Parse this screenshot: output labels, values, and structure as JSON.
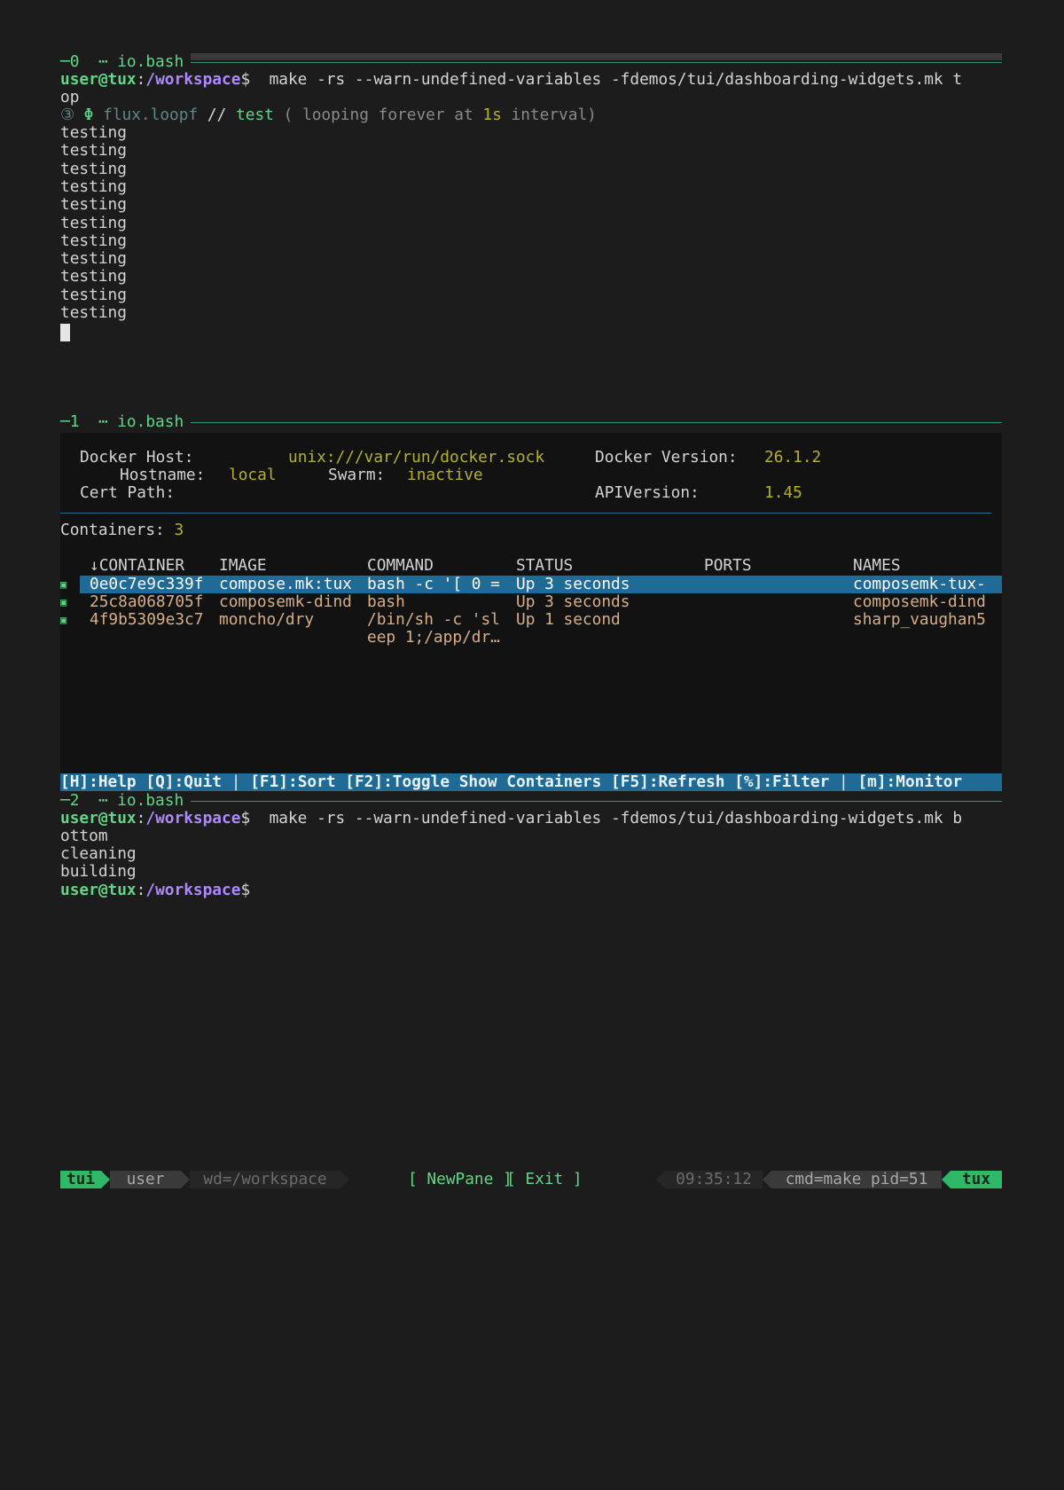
{
  "pane0": {
    "title": "─0  ⋯ io.bash",
    "prompt_user": "user@tux",
    "prompt_sep": ":",
    "prompt_path": "/workspace",
    "prompt_dollar": "$",
    "command_line1": "  make -rs --warn-undefined-variables -fdemos/tui/dashboarding-widgets.mk t",
    "command_line2": "op",
    "flux_icon": "③",
    "flux_glyph": "Φ",
    "flux_name": "flux.loopf",
    "flux_sep": "//",
    "flux_target": "test",
    "flux_msg_a": "( looping forever at ",
    "flux_interval": "1s",
    "flux_msg_b": " interval)",
    "output_lines": [
      "testing",
      "testing",
      "testing",
      "testing",
      "testing",
      "testing",
      "testing",
      "testing",
      "testing",
      "testing",
      "testing"
    ]
  },
  "pane1": {
    "title": "─1  ⋯ io.bash",
    "docker_host_label": "Docker Host:",
    "docker_host_value": "unix:///var/run/docker.sock",
    "docker_version_label": "Docker Version:",
    "docker_version_value": "26.1.2",
    "hostname_label": "Hostname:",
    "hostname_value": "local",
    "swarm_label": "Swarm:",
    "swarm_value": "inactive",
    "cert_path_label": "Cert Path:",
    "api_version_label": "APIVersion:",
    "api_version_value": "1.45",
    "containers_label": "Containers:",
    "containers_count": "3",
    "columns": [
      "↓CONTAINER",
      "IMAGE",
      "COMMAND",
      "STATUS",
      "PORTS",
      "NAMES"
    ],
    "rows": [
      {
        "indicator": "▣",
        "container": "0e0c7e9c339f",
        "image": "compose.mk:tux",
        "command": "bash -c '[ 0 =",
        "status": "Up 3 seconds",
        "ports": "",
        "names": "composemk-tux-"
      },
      {
        "indicator": "▣",
        "container": "25c8a068705f",
        "image": "composemk-dind",
        "command": "bash",
        "status": "Up 3 seconds",
        "ports": "",
        "names": "composemk-dind"
      },
      {
        "indicator": "▣",
        "container": "4f9b5309e3c7",
        "image": "moncho/dry",
        "command": "/bin/sh -c 'sl",
        "status": "Up 1 second",
        "ports": "",
        "names": "sharp_vaughan5"
      }
    ],
    "row3_command_cont": "eep 1;/app/dr…",
    "keys": {
      "help": "[H]:Help",
      "quit": "[Q]:Quit",
      "sep1": "|",
      "sort": "[F1]:Sort",
      "toggle": "[F2]:Toggle Show Containers",
      "refresh": "[F5]:Refresh",
      "filter": "[%]:Filter",
      "sep2": "|",
      "monitor": "[m]:Monitor"
    }
  },
  "pane2": {
    "title": "─2  ⋯ io.bash",
    "command_line1": "  make -rs --warn-undefined-variables -fdemos/tui/dashboarding-widgets.mk b",
    "command_line2": "ottom",
    "output_lines": [
      "cleaning",
      "building"
    ]
  },
  "statusbar": {
    "session": "tui",
    "user": "user",
    "wd": "wd=/workspace",
    "newpane": "[ NewPane ]",
    "exit": "[ Exit ]",
    "time": "09:35:12",
    "cmd": "cmd=make pid=51",
    "host": "tux"
  },
  "colors": {
    "background": "#1c1c1c",
    "accent_green": "#5fd787",
    "path_purple": "#af87ff",
    "dry_highlight": "#1f6b96",
    "olive_value": "#b5b02a",
    "orange_text": "#d7af87"
  }
}
